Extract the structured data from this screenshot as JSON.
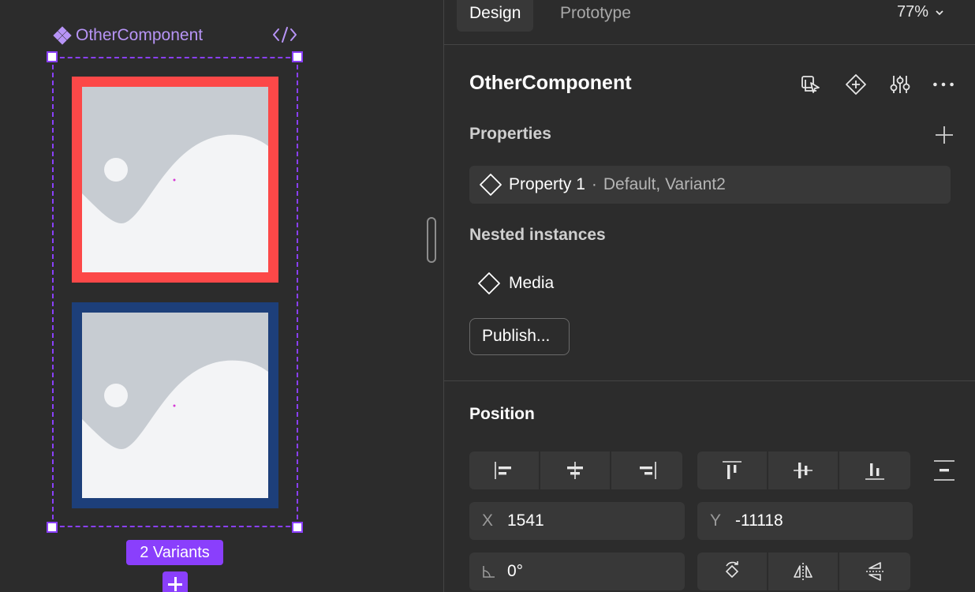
{
  "canvas": {
    "component_label": "OtherComponent",
    "variants_badge": "2 Variants",
    "variant_border_colors": [
      "#fc4848",
      "#1d3f7a"
    ]
  },
  "tabs": {
    "design": "Design",
    "prototype": "Prototype"
  },
  "zoom": "77%",
  "component": {
    "title": "OtherComponent",
    "properties_label": "Properties",
    "property": {
      "name": "Property 1",
      "separator": "·",
      "values": "Default, Variant2"
    },
    "nested_label": "Nested instances",
    "nested_item": "Media",
    "publish_label": "Publish..."
  },
  "position": {
    "title": "Position",
    "x_label": "X",
    "x_value": "1541",
    "y_label": "Y",
    "y_value": "-11118",
    "rotation_value": "0°"
  },
  "colors": {
    "accent": "#8a3ffc",
    "component_label": "#b794f6"
  }
}
